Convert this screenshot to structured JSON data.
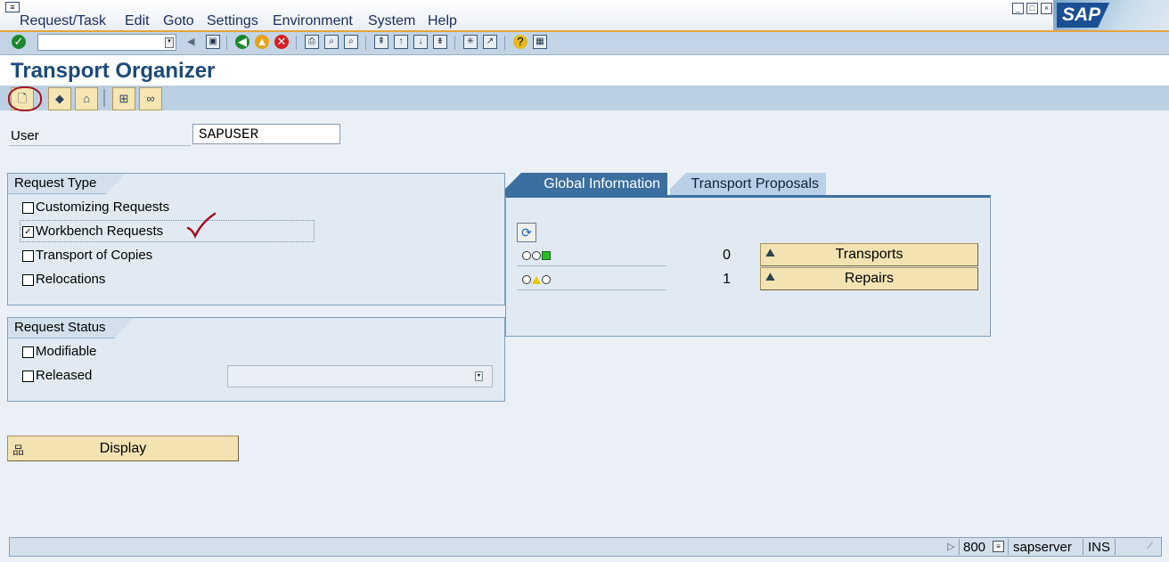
{
  "menubar": {
    "items": [
      "Request/Task",
      "Edit",
      "Goto",
      "Settings",
      "Environment",
      "System",
      "Help"
    ],
    "logo": "SAP"
  },
  "toolbar": {
    "command_value": "",
    "icons": [
      "enter-icon",
      "back-icon",
      "exit-icon",
      "cancel-icon",
      "save-icon",
      "print-icon",
      "find-icon",
      "find-next-icon",
      "first-page-icon",
      "prev-page-icon",
      "next-page-icon",
      "last-page-icon",
      "new-session-icon",
      "shortcut-icon",
      "help-icon",
      "layout-icon"
    ]
  },
  "page": {
    "title": "Transport Organizer"
  },
  "app_toolbar": {
    "icons": [
      "create-icon",
      "display-change-icon",
      "requests-icon",
      "hierarchy-icon",
      "tools-icon"
    ]
  },
  "user": {
    "label": "User",
    "value": "SAPUSER"
  },
  "request_type": {
    "title": "Request Type",
    "items": [
      {
        "label": "Customizing Requests",
        "checked": false
      },
      {
        "label": "Workbench Requests",
        "checked": true
      },
      {
        "label": "Transport of Copies",
        "checked": false
      },
      {
        "label": "Relocations",
        "checked": false
      }
    ]
  },
  "request_status": {
    "title": "Request Status",
    "items": [
      {
        "label": "Modifiable",
        "checked": false
      },
      {
        "label": "Released",
        "checked": false
      }
    ],
    "released_value": ""
  },
  "display_button": {
    "label": "Display"
  },
  "tabs": {
    "active": "Global Information",
    "other": "Transport Proposals"
  },
  "global_info": {
    "rows": [
      {
        "count": "0",
        "button": "Transports"
      },
      {
        "count": "1",
        "button": "Repairs"
      }
    ]
  },
  "status_bar": {
    "client": "800",
    "server": "sapserver",
    "mode": "INS"
  },
  "colors": {
    "accent_orange": "#e8a33a",
    "header_blue": "#1c4a7a",
    "button_tan": "#f3e3b3",
    "annotation_red": "#a01020"
  }
}
